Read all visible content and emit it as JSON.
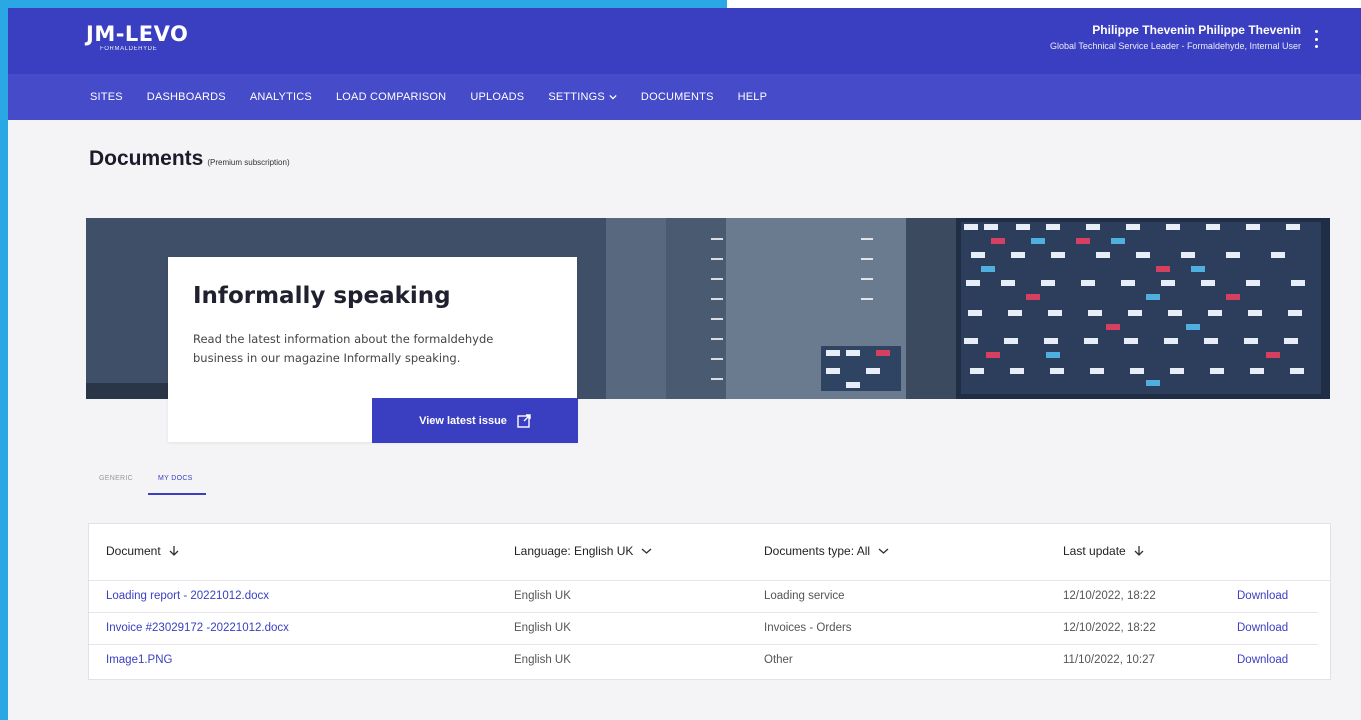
{
  "header": {
    "logo_main": "JM-LEVO",
    "logo_sub": "FORMALDEHYDE",
    "user_name": "Philippe Thevenin Philippe Thevenin",
    "user_role": "Global Technical Service Leader - Formaldehyde, Internal User"
  },
  "nav": {
    "items": [
      "SITES",
      "DASHBOARDS",
      "ANALYTICS",
      "LOAD COMPARISON",
      "UPLOADS",
      "SETTINGS",
      "DOCUMENTS",
      "HELP"
    ]
  },
  "page": {
    "title": "Documents",
    "subtitle": "(Premium subscription)"
  },
  "promo": {
    "title": "Informally speaking",
    "text": "Read the latest information about the formaldehyde business in our magazine Informally speaking.",
    "button": "View latest issue"
  },
  "tabs": [
    "GENERIC",
    "MY DOCS"
  ],
  "table": {
    "headers": {
      "document": "Document",
      "language": "Language: English UK",
      "type": "Documents type: All",
      "updated": "Last update"
    },
    "rows": [
      {
        "document": "Loading report - 20221012.docx",
        "language": "English UK",
        "type": "Loading service",
        "updated": "12/10/2022, 18:22",
        "action": "Download"
      },
      {
        "document": "Invoice #23029172 -20221012.docx",
        "language": "English UK",
        "type": "Invoices - Orders",
        "updated": "12/10/2022, 18:22",
        "action": "Download"
      },
      {
        "document": "Image1.PNG",
        "language": "English UK",
        "type": "Other",
        "updated": "11/10/2022, 10:27",
        "action": "Download"
      }
    ]
  },
  "colors": {
    "brand": "#3a3fc1",
    "nav": "#454bc9",
    "frame": "#2aa8e6"
  }
}
